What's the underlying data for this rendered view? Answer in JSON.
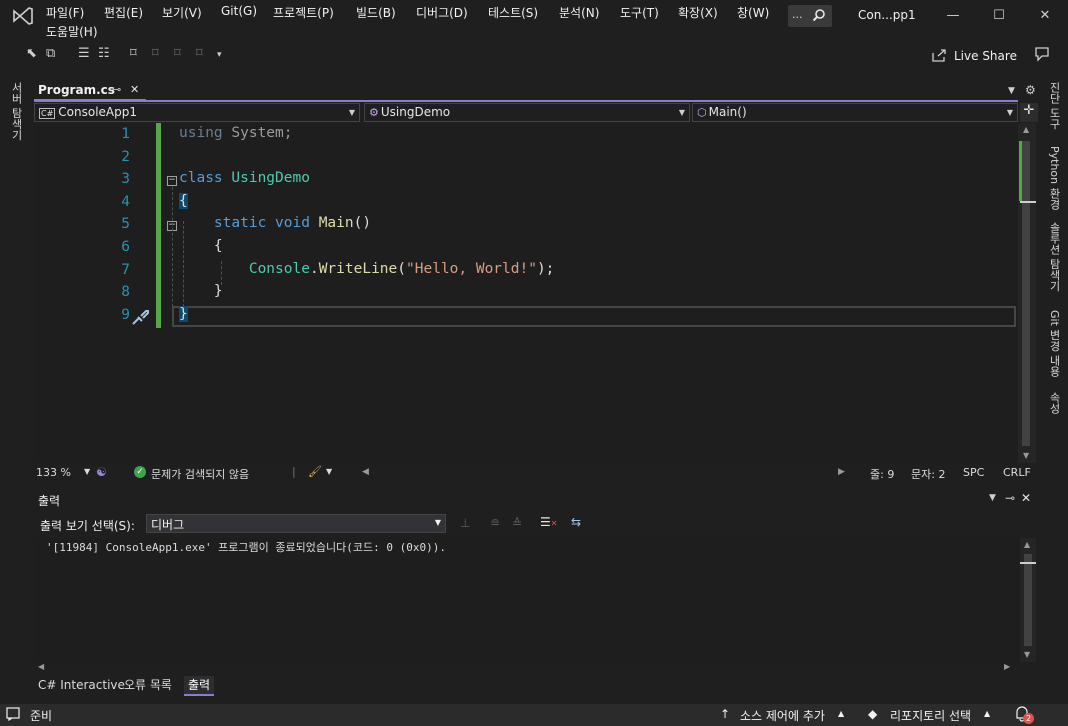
{
  "menu": {
    "items": [
      "파일(F)",
      "편집(E)",
      "보기(V)",
      "Git(G)",
      "프로젝트(P)",
      "빌드(B)",
      "디버그(D)",
      "테스트(S)",
      "분석(N)",
      "도구(T)",
      "확장(X)",
      "창(W)"
    ],
    "help": "도움말(H)",
    "search_dots": "...",
    "window_title": "Con...pp1"
  },
  "toolbar": {
    "live_share": "Live Share"
  },
  "left_strip": {
    "server_explorer": "서버 탐색기"
  },
  "right_strip": {
    "items": [
      "진단 도구",
      "Python 환경",
      "솔루션 탐색기",
      "Git 변경 내용",
      "속성"
    ]
  },
  "editor": {
    "tab_label": "Program.cs",
    "tab_pin": "⊸",
    "tab_close": "✕",
    "nav": {
      "project": "ConsoleApp1",
      "class": "UsingDemo",
      "member": "Main()"
    },
    "line_numbers": [
      "1",
      "2",
      "3",
      "4",
      "5",
      "6",
      "7",
      "8",
      "9"
    ],
    "code": {
      "l1_kw": "using",
      "l1_rest": " System;",
      "l3_kw": "class",
      "l3_name": "UsingDemo",
      "l4": "{",
      "l5_kw": "static void",
      "l5_fn": "Main",
      "l5_rest": "()",
      "l6": "{",
      "l7_ty": "Console",
      "l7_dot": ".",
      "l7_fn": "WriteLine",
      "l7_open": "(",
      "l7_str": "\"Hello, World!\"",
      "l7_close": ");",
      "l8": "}",
      "l9": "}"
    },
    "status": {
      "zoom": "133 %",
      "issues": "문제가 검색되지 않음",
      "line": "줄: 9",
      "char": "문자: 2",
      "spc": "SPC",
      "crlf": "CRLF"
    }
  },
  "output": {
    "title": "출력",
    "source_label": "출력 보기 선택(S):",
    "source_value": "디버그",
    "lines": [
      "'[11984] ConsoleApp1.exe' 프로그램이 종료되었습니다(코드: 0 (0x0))."
    ],
    "tabs": [
      "C# Interactive",
      "오류 목록",
      "출력"
    ]
  },
  "statusbar": {
    "ready": "준비",
    "add_source_control": "소스 제어에 추가",
    "repo_select": "리포지토리 선택",
    "notifications": "2"
  },
  "colors": {
    "accent": "#8c7cd0",
    "change_bar": "#57a64a",
    "line_number": "#2b91af",
    "keyword": "#569cd6",
    "type": "#4ec9b0",
    "method": "#dcdcaa",
    "string": "#d69d85",
    "notification_badge": "#e05252"
  }
}
